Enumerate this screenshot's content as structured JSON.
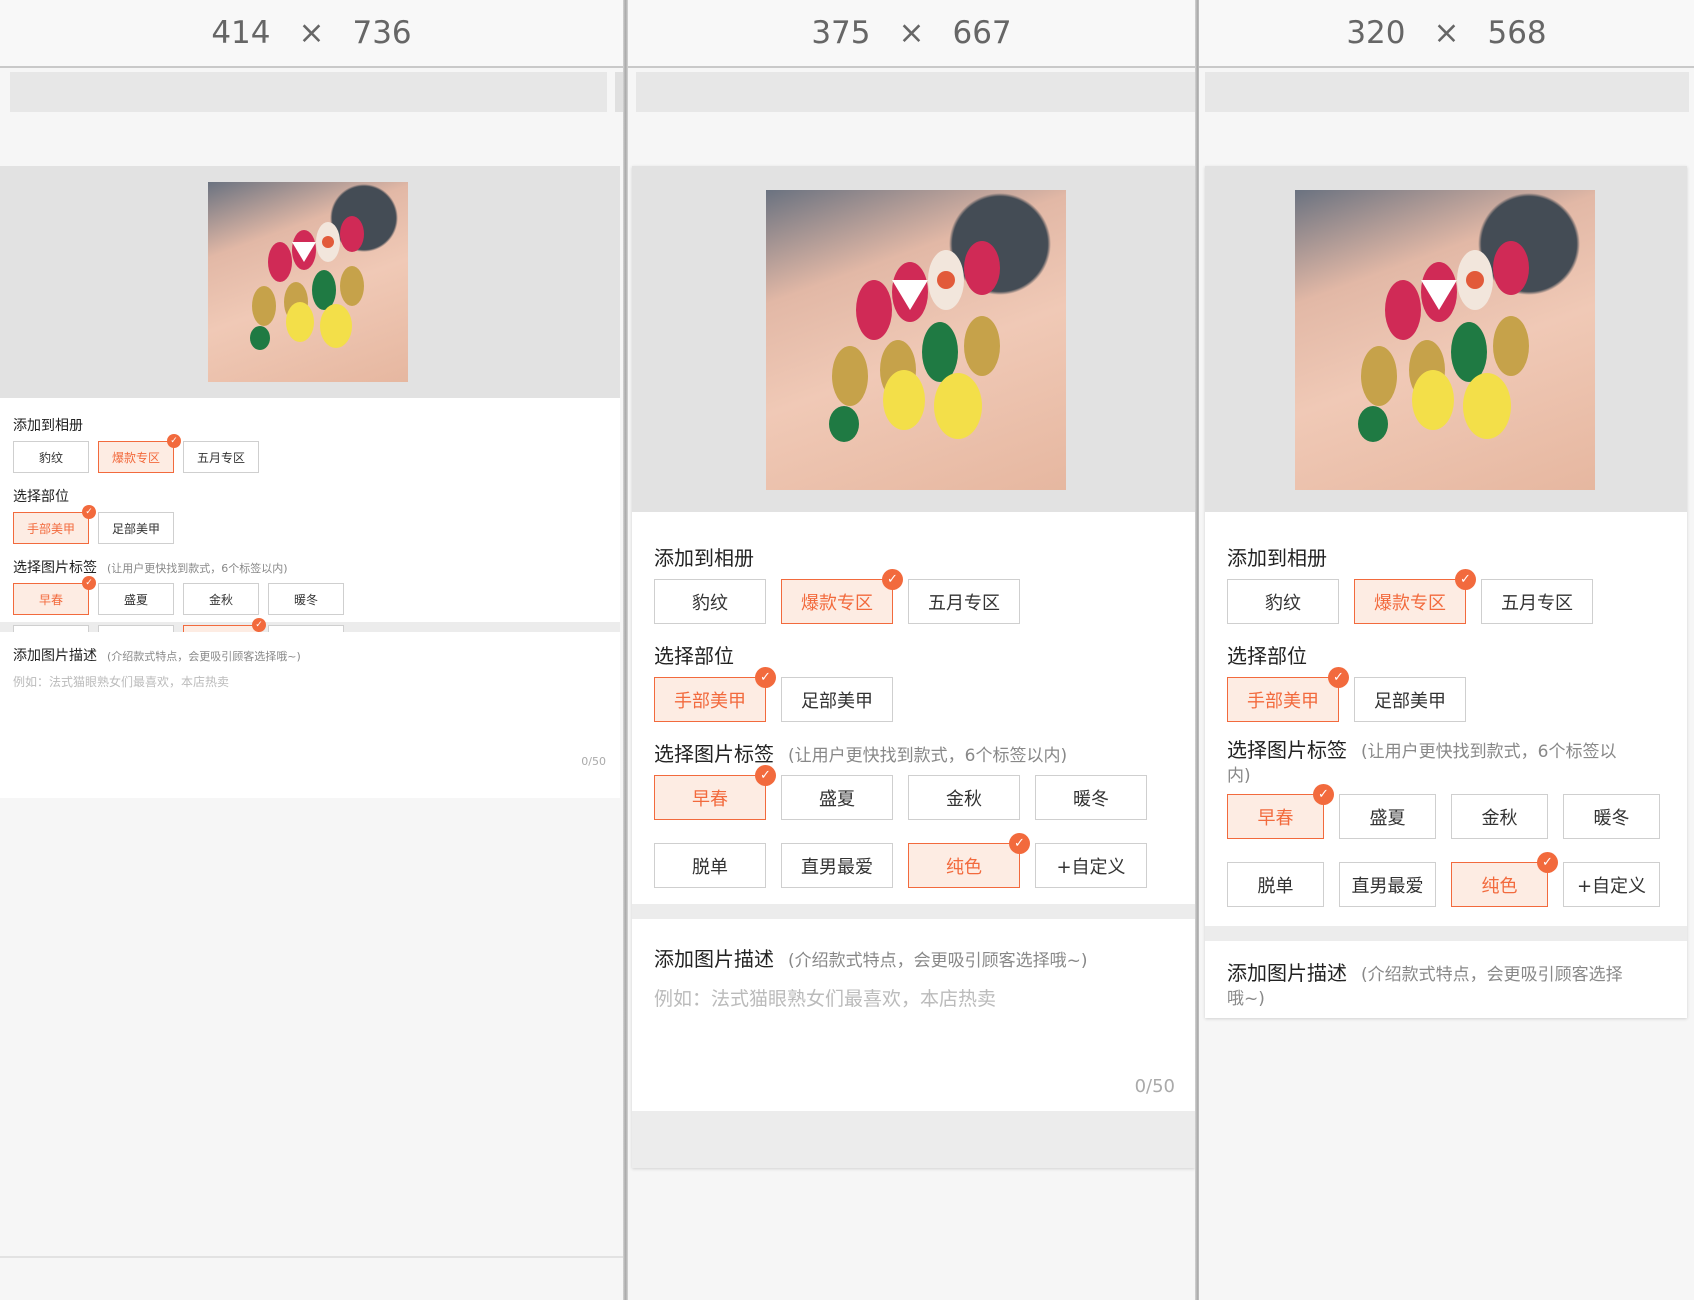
{
  "viewports": [
    {
      "w": "414",
      "h": "736",
      "x": "×"
    },
    {
      "w": "375",
      "h": "667",
      "x": "×"
    },
    {
      "w": "320",
      "h": "568",
      "x": "×"
    }
  ],
  "album": {
    "title": "添加到相册",
    "options": [
      "豹纹",
      "爆款专区",
      "五月专区"
    ],
    "selected_index": 1
  },
  "position": {
    "title": "选择部位",
    "options": [
      "手部美甲",
      "足部美甲"
    ],
    "selected_index": 0
  },
  "tags": {
    "title": "选择图片标签",
    "hint": "(让用户更快找到款式，6个标签以内)",
    "hint_c_line1": "(让用户更快找到款式，6个标签以",
    "hint_c_line2": "内)",
    "row1": [
      "早春",
      "盛夏",
      "金秋",
      "暖冬"
    ],
    "row2": [
      "脱单",
      "直男最爱",
      "纯色",
      "+自定义"
    ],
    "selected": [
      "早春",
      "纯色"
    ]
  },
  "description": {
    "title": "添加图片描述",
    "hint": "(介绍款式特点，会更吸引顾客选择哦~)",
    "hint_c_line1": "(介绍款式特点，会更吸引顾客选择",
    "hint_c_line2": "哦~)",
    "placeholder": "例如：法式猫眼熟女们最喜欢，本店热卖",
    "counter": "0/50"
  },
  "check_glyph": "✓",
  "colors": {
    "accent": "#f26a3d",
    "accent_bg": "#fdece3"
  }
}
